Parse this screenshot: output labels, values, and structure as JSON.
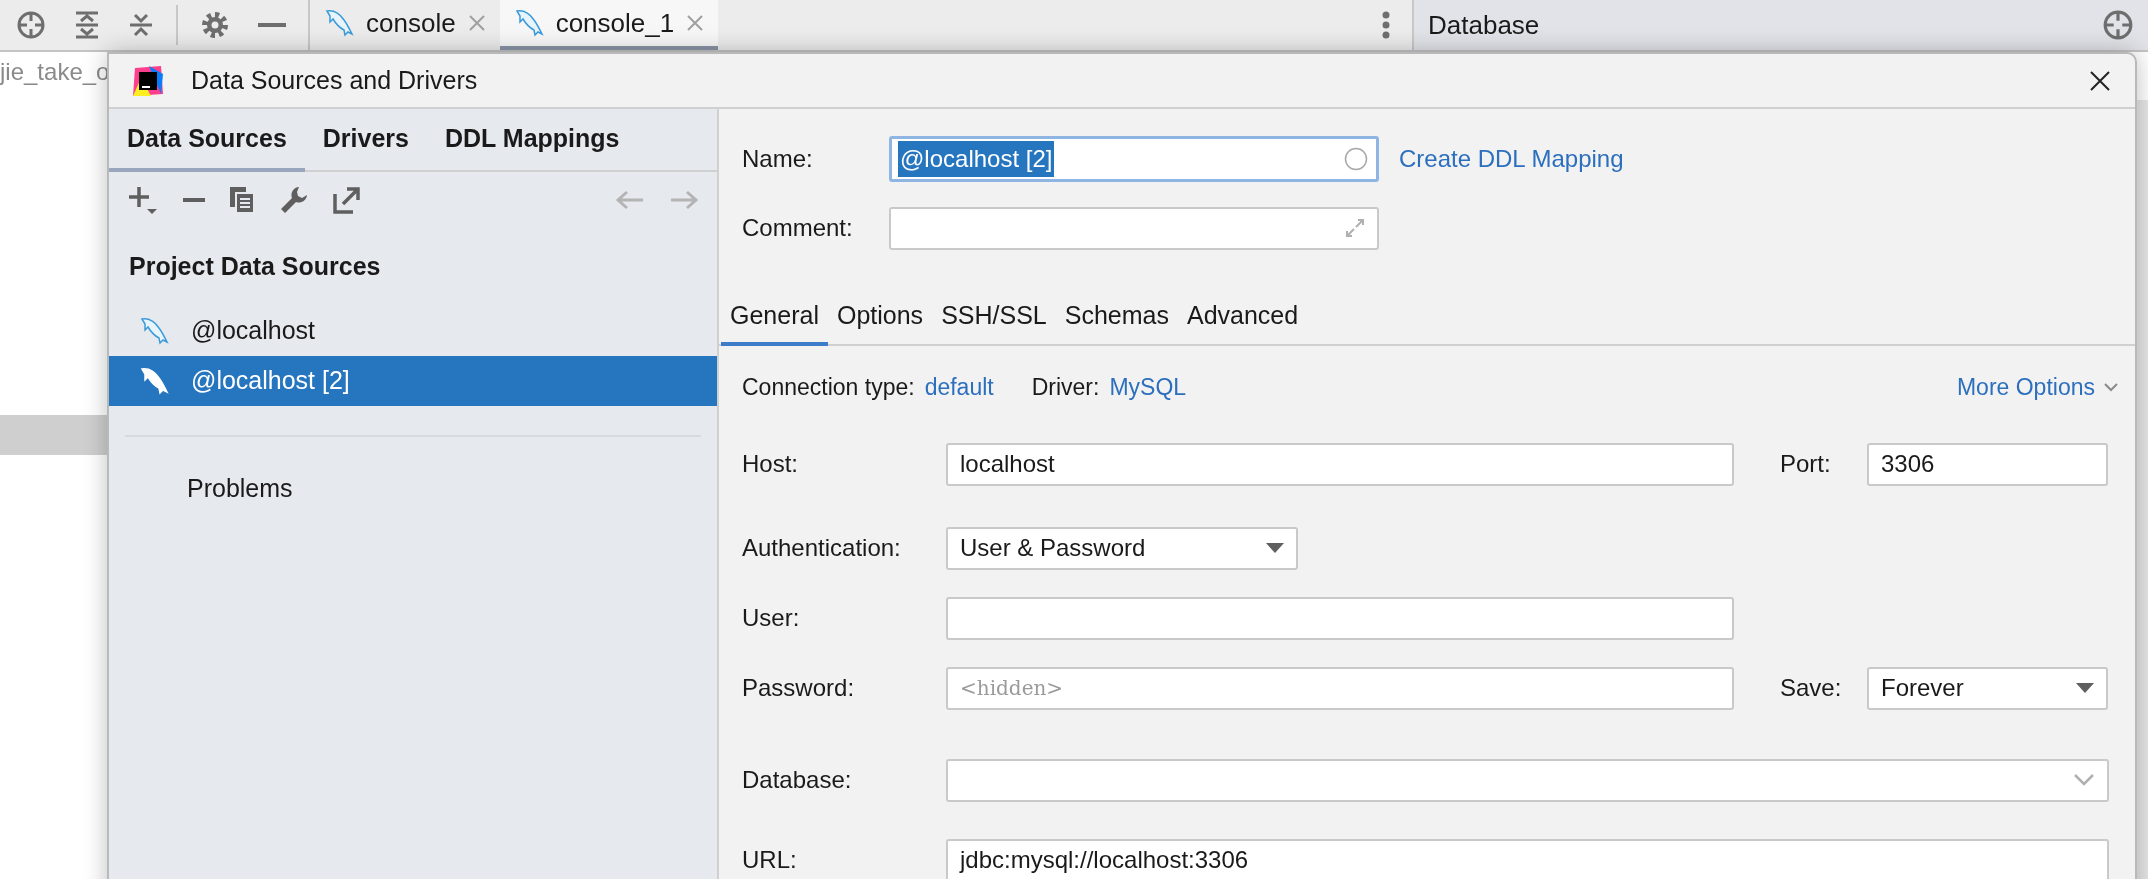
{
  "toolbar": {
    "tabs": [
      {
        "label": "console",
        "selected": false
      },
      {
        "label": "console_1",
        "selected": true
      }
    ],
    "panel_title": "Database"
  },
  "background_editor": {
    "text": "jie_take_o"
  },
  "dialog": {
    "title": "Data Sources and Drivers",
    "left_tabs": [
      {
        "label": "Data Sources",
        "selected": true
      },
      {
        "label": "Drivers",
        "selected": false
      },
      {
        "label": "DDL Mappings",
        "selected": false
      }
    ],
    "section_title": "Project Data Sources",
    "sources": [
      {
        "label": "@localhost",
        "selected": false
      },
      {
        "label": "@localhost [2]",
        "selected": true
      }
    ],
    "problems": "Problems",
    "name": {
      "label": "Name:",
      "value": "@localhost [2]"
    },
    "create_link": "Create DDL Mapping",
    "comment": {
      "label": "Comment:"
    },
    "tabs": [
      {
        "label": "General",
        "selected": true
      },
      {
        "label": "Options",
        "selected": false
      },
      {
        "label": "SSH/SSL",
        "selected": false
      },
      {
        "label": "Schemas",
        "selected": false
      },
      {
        "label": "Advanced",
        "selected": false
      }
    ],
    "connection_type": {
      "label": "Connection type:",
      "value": "default"
    },
    "driver": {
      "label": "Driver:",
      "value": "MySQL"
    },
    "more_options": "More Options",
    "host": {
      "label": "Host:",
      "value": "localhost"
    },
    "port": {
      "label": "Port:",
      "value": "3306"
    },
    "authentication": {
      "label": "Authentication:",
      "value": "User & Password"
    },
    "user": {
      "label": "User:"
    },
    "password": {
      "label": "Password:",
      "placeholder": "<hidden>"
    },
    "save": {
      "label": "Save:",
      "value": "Forever"
    },
    "database": {
      "label": "Database:"
    },
    "url": {
      "label": "URL:",
      "value": "jdbc:mysql://localhost:3306"
    }
  }
}
